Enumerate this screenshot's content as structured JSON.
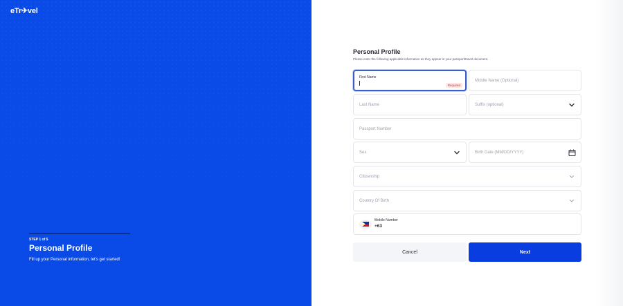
{
  "brand": {
    "logo_text": "eTr✈vel"
  },
  "left": {
    "step_label": "STEP 1 of 5",
    "title": "Personal Profile",
    "subtitle": "Fill up your Personal information, let's get started!"
  },
  "form": {
    "title": "Personal Profile",
    "subtitle": "Please enter the following applicable information as they appear in your passport/travel document.",
    "first_name": {
      "label": "First Name",
      "value": "",
      "badge": "Required"
    },
    "middle_name": {
      "placeholder": "Middle Name (Optional)"
    },
    "last_name": {
      "placeholder": "Last Name"
    },
    "suffix": {
      "placeholder": "Suffix (optional)"
    },
    "passport": {
      "placeholder": "Passport Number"
    },
    "sex": {
      "placeholder": "Sex"
    },
    "birth_date": {
      "placeholder": "Birth Date (MM/DD/YYYY)"
    },
    "citizenship": {
      "placeholder": "Citizenship"
    },
    "country_of_birth": {
      "placeholder": "Country Of Birth"
    },
    "mobile": {
      "label": "Mobile Number",
      "code": "+63"
    }
  },
  "buttons": {
    "cancel": "Cancel",
    "next": "Next"
  },
  "icons": {
    "chevron": "chevron-down-icon",
    "calendar": "calendar-icon",
    "flag": "philippines-flag-icon"
  },
  "colors": {
    "primary": "#0a4be8",
    "button": "#0a3de0",
    "required": "#c0392b"
  }
}
